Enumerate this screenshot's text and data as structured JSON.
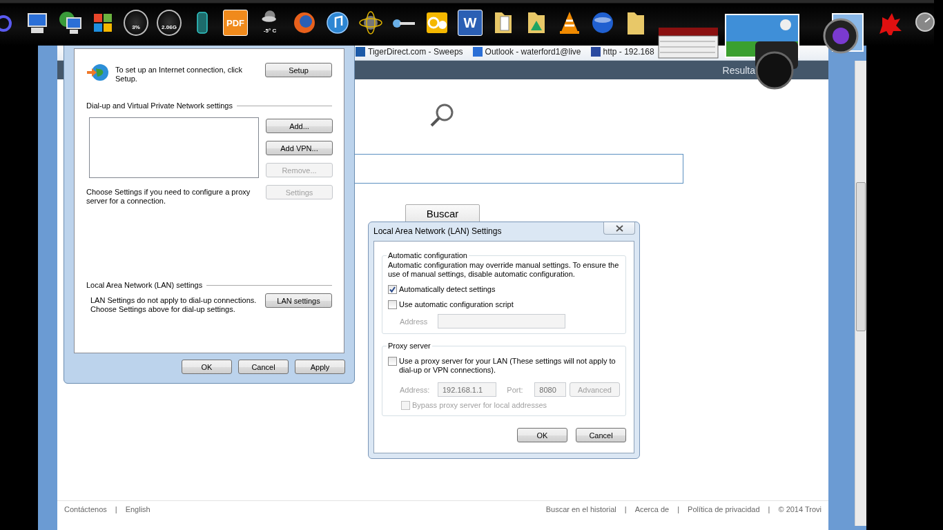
{
  "dock": {
    "gauges": [
      "3%",
      "2.06G"
    ],
    "weather": "-5° C",
    "pdf_label": "PDF",
    "word_label": "W"
  },
  "browser": {
    "bookmarks": [
      "TigerDirect.com - Sweeps",
      "Outlook - waterford1@live",
      "http - 192.168"
    ],
    "header_text": "Resulta",
    "search_button": "Buscar",
    "separator": "|",
    "footer_left": [
      "Contáctenos",
      "English"
    ],
    "footer_right": [
      "Buscar en el historial",
      "Acerca de",
      "Política de privacidad",
      "© 2014 Trovi"
    ]
  },
  "internet_properties": {
    "setup_text": "To set up an Internet connection, click Setup.",
    "setup_button": "Setup",
    "vpn_section": "Dial-up and Virtual Private Network settings",
    "vpn_buttons": [
      {
        "label": "Add...",
        "disabled": false
      },
      {
        "label": "Add VPN...",
        "disabled": false
      },
      {
        "label": "Remove...",
        "disabled": true
      }
    ],
    "proxy_text": "Choose Settings if you need to configure a proxy server for a connection.",
    "settings_button": {
      "label": "Settings",
      "disabled": true
    },
    "lan_section": "Local Area Network (LAN) settings",
    "lan_text": "LAN Settings do not apply to dial-up connections. Choose Settings above for dial-up settings.",
    "lan_button": "LAN settings",
    "buttons": [
      "OK",
      "Cancel",
      "Apply"
    ]
  },
  "lan_dialog": {
    "title": "Local Area Network (LAN) Settings",
    "auto_group": "Automatic configuration",
    "auto_text": "Automatic configuration may override manual settings.  To ensure the use of manual settings, disable automatic configuration.",
    "auto_options": [
      {
        "label": "Automatically detect settings",
        "checked": true
      },
      {
        "label": "Use automatic configuration script",
        "checked": false
      }
    ],
    "script_address": {
      "label": "Address",
      "disabled": true
    },
    "proxy_group": "Proxy server",
    "proxy_option": {
      "label": "Use a proxy server for your LAN (These settings will not apply to dial-up or VPN connections).",
      "checked": false
    },
    "proxy_settings": {
      "disabled": true,
      "address_label": "Address:",
      "address_value": "192.168.1.1",
      "port_label": "Port:",
      "port_value": "8080",
      "advanced_button": "Advanced",
      "bypass": {
        "label": "Bypass proxy server for local addresses",
        "checked": false
      }
    },
    "buttons": [
      "OK",
      "Cancel"
    ]
  }
}
